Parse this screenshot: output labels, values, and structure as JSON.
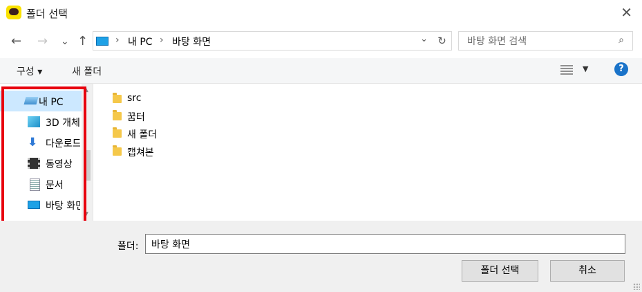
{
  "window": {
    "title": "폴더 선택",
    "close_label": "✕"
  },
  "nav": {
    "back": "←",
    "forward": "→",
    "recent": "⌄",
    "up": "↑",
    "breadcrumb": [
      "내 PC",
      "바탕 화면"
    ],
    "sep": "›",
    "dropdown": "⌄",
    "refresh": "↻"
  },
  "search": {
    "placeholder": "바탕 화면 검색",
    "icon": "search-icon"
  },
  "commands": {
    "organize": "구성 ▾",
    "new_folder": "새 폴더",
    "view_dropdown": "▼",
    "help": "?"
  },
  "sidebar": {
    "items": [
      {
        "label": "내 PC",
        "icon": "pc-icon",
        "selected": true
      },
      {
        "label": "3D 개체",
        "icon": "cube-icon"
      },
      {
        "label": "다운로드",
        "icon": "download-icon"
      },
      {
        "label": "동영상",
        "icon": "video-icon"
      },
      {
        "label": "문서",
        "icon": "document-icon"
      },
      {
        "label": "바탕 화면",
        "icon": "desktop-icon"
      }
    ],
    "scroll_up": "▲",
    "scroll_down": "▼"
  },
  "files": [
    {
      "name": "src"
    },
    {
      "name": "꿈터"
    },
    {
      "name": "새 폴더"
    },
    {
      "name": "캡쳐본"
    }
  ],
  "footer": {
    "folder_label": "폴더:",
    "folder_value": "바탕 화면",
    "select_button": "폴더 선택",
    "cancel_button": "취소"
  },
  "colors": {
    "accent": "#1a73c9",
    "highlight": "#e8000e",
    "selected": "#cce8ff"
  }
}
